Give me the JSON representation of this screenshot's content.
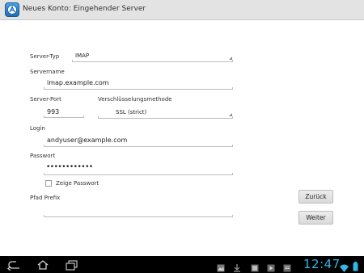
{
  "window": {
    "title": "Neues Konto: Eingehender Server"
  },
  "form": {
    "server_type": {
      "label": "Server-Typ",
      "value": "IMAP"
    },
    "server_name": {
      "label": "Servername",
      "value": "imap.example.com"
    },
    "server_port": {
      "label": "Server-Port",
      "value": "993"
    },
    "encryption": {
      "label": "Verschlüsselungsmethode",
      "value": "SSL (strict)"
    },
    "login": {
      "label": "Login",
      "value": "andyuser@example.com"
    },
    "password": {
      "label": "Passwort",
      "value": "••••••••••••"
    },
    "show_password": {
      "label": "Zeige Passwort",
      "checked": false
    },
    "path_prefix": {
      "label": "Pfad Prefix",
      "value": ""
    }
  },
  "buttons": {
    "back_label": "Zurück",
    "next_label": "Weiter"
  },
  "statusbar": {
    "time": "12:47"
  },
  "colors": {
    "accent": "#33b5e5",
    "titlebar": "#e3e3e3",
    "navbar": "#000000"
  }
}
